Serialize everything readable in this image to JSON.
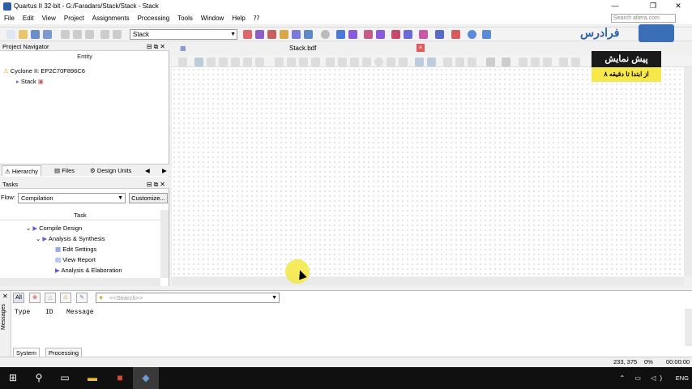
{
  "window": {
    "title": "Quartus II 32-bit - G:/Faradars/Stack/Stack - Stack",
    "minimize": "—",
    "maximize": "❐",
    "close": "✕"
  },
  "menu": [
    "File",
    "Edit",
    "View",
    "Project",
    "Assignments",
    "Processing",
    "Tools",
    "Window",
    "Help"
  ],
  "search_placeholder": "Search altera.com",
  "toolbar": {
    "revision": "Stack"
  },
  "project_navigator": {
    "title": "Project Navigator",
    "column": "Entity",
    "device": "Cyclone II: EP2C70F896C6",
    "top_entity": "Stack",
    "tabs": [
      "Hierarchy",
      "Files",
      "Design Units"
    ]
  },
  "tasks": {
    "title": "Tasks",
    "flow_label": "Flow:",
    "flow_value": "Compilation",
    "customize": "Customize...",
    "column": "Task",
    "items": [
      {
        "label": "Compile Design"
      },
      {
        "label": "Analysis & Synthesis"
      },
      {
        "label": "Edit Settings"
      },
      {
        "label": "View Report"
      },
      {
        "label": "Analysis & Elaboration"
      }
    ]
  },
  "editor": {
    "tab": "Stack.bdf"
  },
  "messages": {
    "side_label": "Messages",
    "filter_all": "All",
    "search_placeholder": "<<Search>>",
    "columns": [
      "Type",
      "ID",
      "Message"
    ],
    "tabs": [
      "System",
      "Processing"
    ]
  },
  "status": {
    "coords": "233, 375",
    "zoom": "0%",
    "time": "00:00:00"
  },
  "taskbar": {
    "lang": "ENG"
  },
  "watermark": {
    "logo": "فرادرس",
    "banner_title": "پیش نمایش",
    "banner_sub": "از ابتدا تا دقیقه ۸"
  },
  "colors": {
    "accent": "#2b5fa8",
    "highlight": "#f5e84b",
    "taskbar": "#101010"
  }
}
